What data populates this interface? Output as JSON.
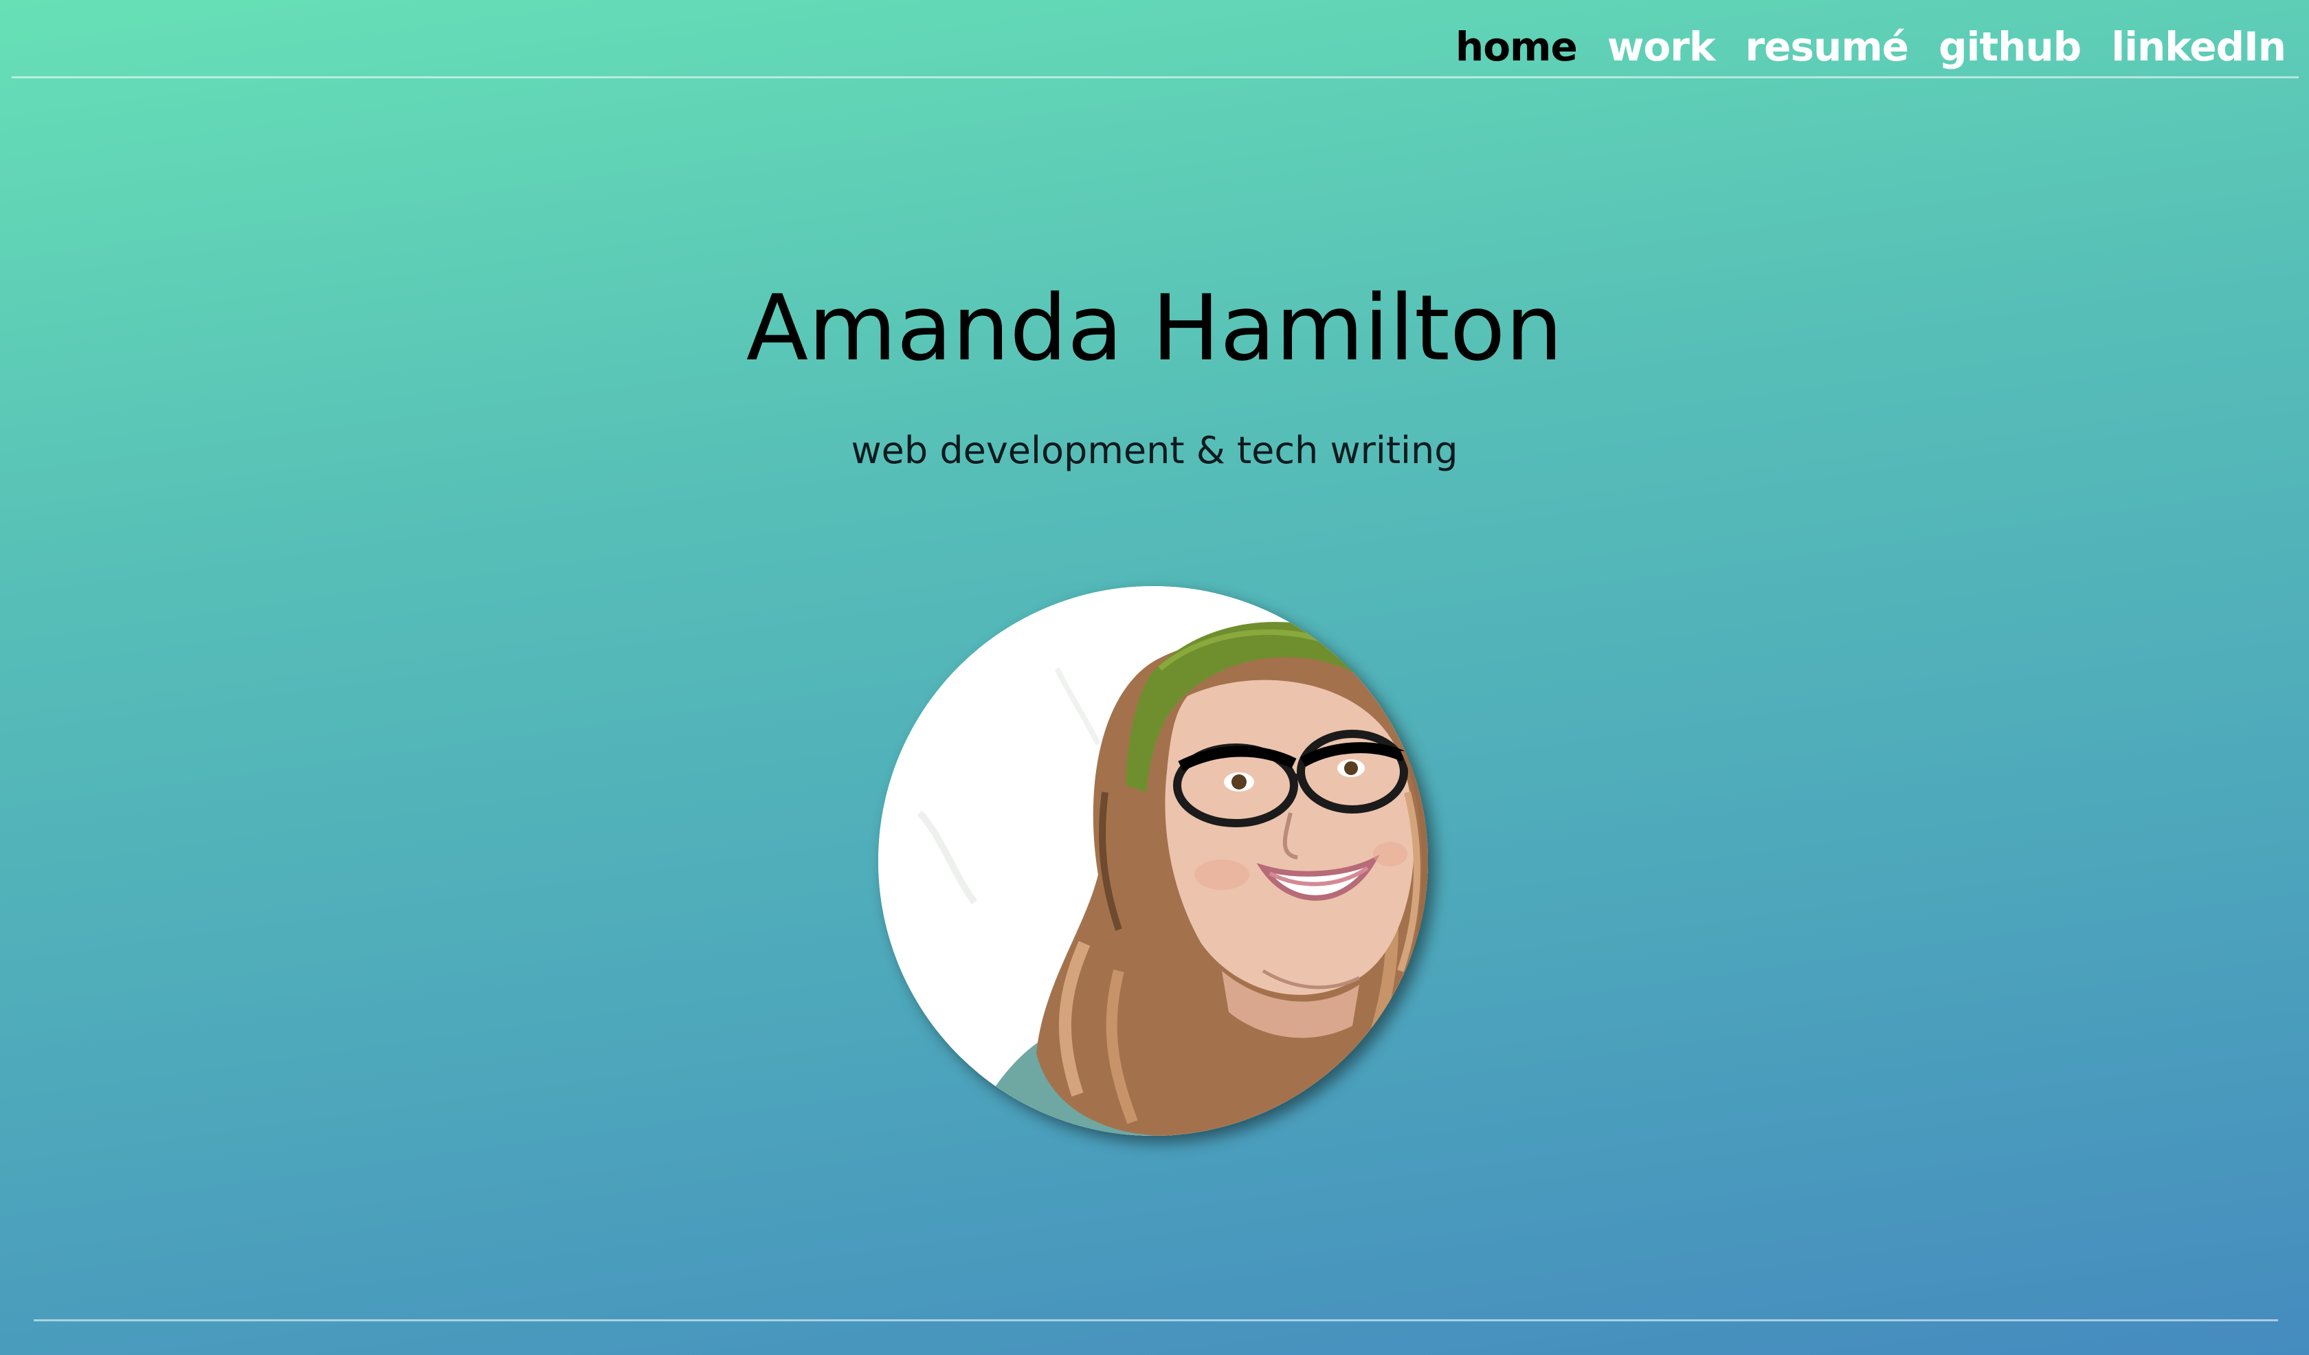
{
  "nav": {
    "items": [
      {
        "label": "home",
        "active": true
      },
      {
        "label": "work",
        "active": false
      },
      {
        "label": "resumé",
        "active": false
      },
      {
        "label": "github",
        "active": false
      },
      {
        "label": "linkedIn",
        "active": false
      }
    ]
  },
  "hero": {
    "name": "Amanda Hamilton",
    "tagline": "web development & tech writing"
  },
  "avatar": {
    "icon": "portrait-illustration"
  },
  "colors": {
    "gradient_top": "#67e0b6",
    "gradient_bottom": "#458bbf",
    "nav_active": "#000000",
    "nav_inactive": "#ffffff"
  }
}
